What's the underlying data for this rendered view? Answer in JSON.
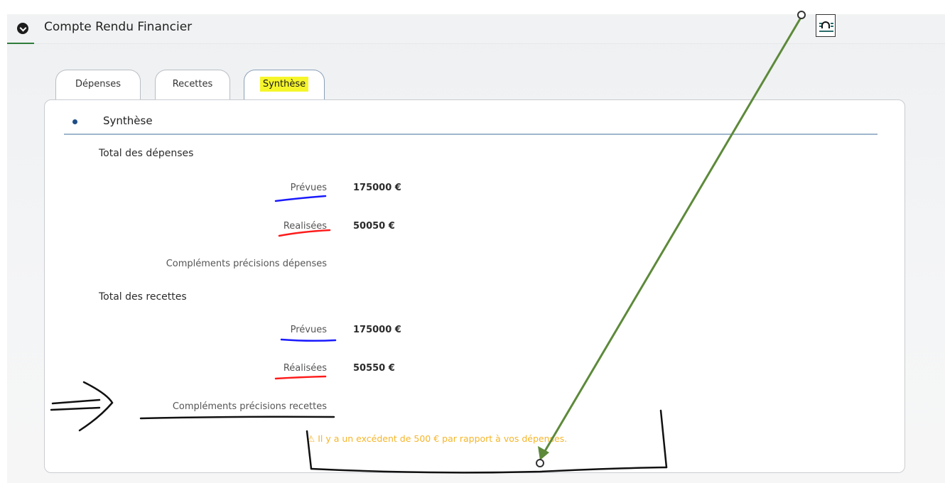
{
  "header": {
    "title": "Compte Rendu Financier",
    "toggle_icon": "chevron-down-icon",
    "corner_icon": "document-arch-icon"
  },
  "tabs": [
    {
      "label": "Dépenses",
      "active": false
    },
    {
      "label": "Recettes",
      "active": false
    },
    {
      "label": "Synthèse",
      "active": true
    }
  ],
  "synthese": {
    "section_title": "Synthèse",
    "depenses": {
      "heading": "Total des dépenses",
      "prevues_label": "Prévues",
      "prevues_value": "175000 €",
      "realisees_label": "Realisées",
      "realisees_value": "50050 €",
      "complement_label": "Compléments précisions dépenses"
    },
    "recettes": {
      "heading": "Total des recettes",
      "prevues_label": "Prévues",
      "prevues_value": "175000 €",
      "realisees_label": "Réalisées",
      "realisees_value": "50550 €",
      "complement_label": "Compléments précisions recettes"
    },
    "warning": "Il y a un excédent de 500 € par rapport à vos dépenses."
  },
  "colors": {
    "warning": "#f5b52a",
    "highlight": "#f5f52a",
    "accent_green": "#2f7d3a",
    "annotation_blue": "#1a1aff",
    "annotation_red": "#ff1a1a",
    "annotation_arrow": "#5d8a3a"
  }
}
